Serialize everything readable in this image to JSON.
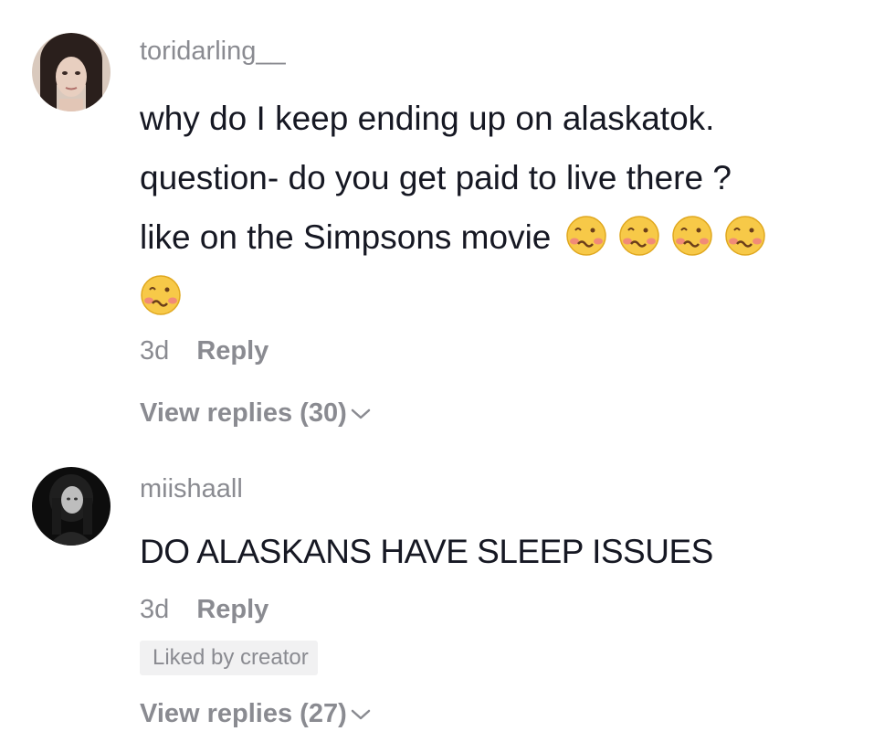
{
  "comments": [
    {
      "username": "toridarling__",
      "text_lines": [
        "why do I keep ending up on alaskatok.",
        "question- do you get paid to live there ?",
        "like on the Simpsons movie"
      ],
      "emoji_name": "woozy-face",
      "emoji_count": 5,
      "age": "3d",
      "reply_label": "Reply",
      "view_replies": "View replies (30)"
    },
    {
      "username": "miishaall",
      "text": "DO ALASKANS HAVE SLEEP ISSUES",
      "age": "3d",
      "reply_label": "Reply",
      "badge": "Liked by creator",
      "view_replies": "View replies (27)"
    }
  ],
  "colors": {
    "primary_text": "#161823",
    "secondary_text": "#8a8b91",
    "badge_bg": "#f1f1f2"
  }
}
